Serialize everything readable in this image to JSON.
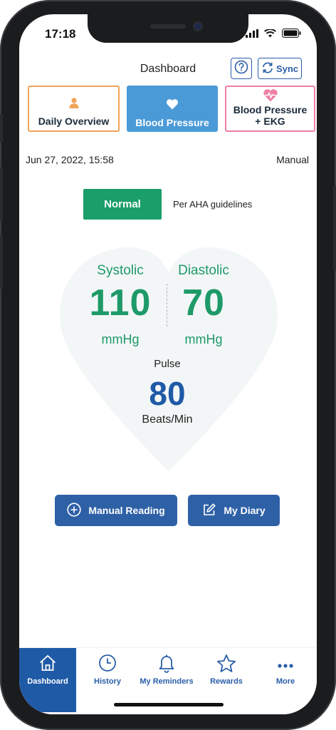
{
  "status_bar": {
    "time": "17:18"
  },
  "header": {
    "title": "Dashboard",
    "sync_label": "Sync"
  },
  "categories": [
    {
      "label": "Daily Overview",
      "icon": "person-icon",
      "color": "#f0a45a"
    },
    {
      "label": "Blood Pressure",
      "icon": "heart-icon",
      "color": "#4a9ad8",
      "selected": true
    },
    {
      "label_line1": "Blood Pressure",
      "label_line2": "+ EKG",
      "icon": "heart-pulse-icon",
      "color": "#ee7fa6"
    }
  ],
  "reading": {
    "datetime": "Jun 27, 2022, 15:58",
    "mode": "Manual",
    "status": "Normal",
    "guideline": "Per AHA guidelines",
    "systolic_label": "Systolic",
    "systolic_value": "110",
    "systolic_unit": "mmHg",
    "diastolic_label": "Diastolic",
    "diastolic_value": "70",
    "diastolic_unit": "mmHg",
    "pulse_label": "Pulse",
    "pulse_value": "80",
    "pulse_unit": "Beats/Min"
  },
  "actions": {
    "manual_reading": "Manual Reading",
    "my_diary": "My Diary"
  },
  "nav": [
    {
      "label": "Dashboard",
      "icon": "home-icon",
      "active": true
    },
    {
      "label": "History",
      "icon": "clock-icon"
    },
    {
      "label": "My Reminders",
      "icon": "bell-icon"
    },
    {
      "label": "Rewards",
      "icon": "star-icon"
    },
    {
      "label": "More",
      "icon": "more-icon"
    }
  ],
  "colors": {
    "accent": "#2a5ea8",
    "normal_green": "#1a9e6a",
    "vitals_green": "#1e9a68",
    "pulse_blue": "#1f5aa6"
  }
}
